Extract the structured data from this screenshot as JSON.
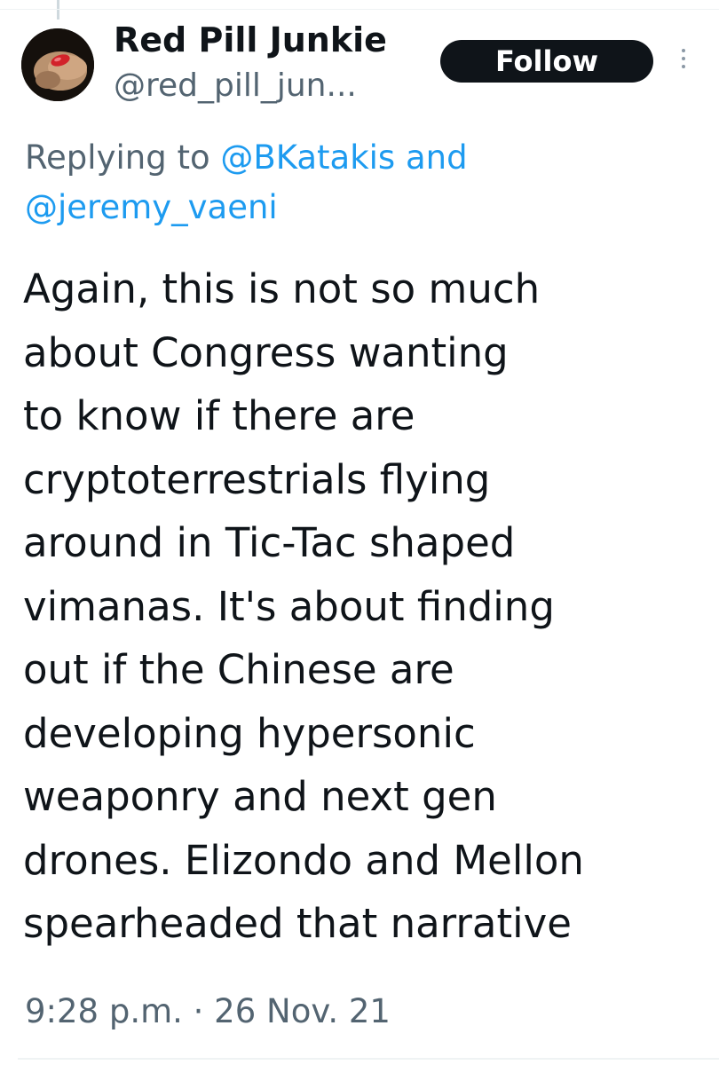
{
  "tweet": {
    "author_name": "Red Pill Junkie",
    "author_handle": "@red_pill_jun...",
    "follow_label": "Follow",
    "reply_prefix": "Replying to",
    "reply_mention_1": "@BKatakis",
    "reply_and": "and",
    "reply_mention_2": "@jeremy_vaeni",
    "body_lines": [
      "Again, this is not so much",
      "about Congress wanting",
      "to know if there are",
      "cryptoterrestrials flying",
      "around in Tic-Tac shaped",
      "vimanas. It's about finding",
      "out if the Chinese are",
      "developing hypersonic",
      "weaponry and next gen",
      "drones. Elizondo and Mellon",
      "spearheaded that narrative"
    ],
    "timestamp": "9:28 p.m. · 26 Nov. 21"
  },
  "icons": {
    "more": "more-options-icon",
    "avatar": "avatar-image"
  },
  "colors": {
    "text_primary": "#0f1419",
    "text_secondary": "#536471",
    "link": "#1d9bf0",
    "button_bg": "#0f1419",
    "button_text": "#ffffff"
  }
}
